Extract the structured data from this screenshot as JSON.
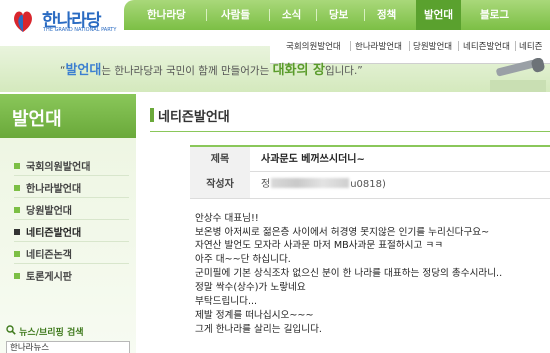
{
  "header": {
    "logo_text": "한나라당",
    "logo_sub": "THE GRAND NATIONAL PARTY",
    "top_nav": [
      "한나라당",
      "사람들",
      "소식",
      "당보",
      "정책",
      "발언대",
      "블로그"
    ],
    "active_top": "발언대",
    "sub_nav": [
      "국회의원발언대",
      "한나라발언대",
      "당원발언대",
      "네티즌발언대",
      "네티즌"
    ],
    "slogan": {
      "pre": "“",
      "word1": "발언대",
      "mid": "는 한나라당과 국민이 함께 만들어가는 ",
      "word2": "대화의 장",
      "post": "입니다.”"
    }
  },
  "sidebar": {
    "title": "발언대",
    "items": [
      {
        "label": "국회의원발언대"
      },
      {
        "label": "한나라발언대"
      },
      {
        "label": "당원발언대"
      },
      {
        "label": "네티즌발언대",
        "active": true
      },
      {
        "label": "네티즌논객"
      },
      {
        "label": "토론게시판"
      }
    ],
    "news_title": "뉴스/브리핑 검색",
    "news_select_value": "한나라뉴스"
  },
  "main": {
    "title": "네티즌발언대",
    "subject_label": "제목",
    "subject_value": "사과문도 베꺼쓰시더니~",
    "writer_label": "작성자",
    "writer_prefix": "정",
    "writer_suffix": "u0818)",
    "body_lines": [
      "안상수 대표님!!",
      "보온병 아저씨로 젊은층 사이에서 허경영 못지않은 인기를 누리신다구요~",
      "자연산 발언도 모자라 사과문 마저 MB사과문 표절하시고 ㅋㅋ",
      "아주 대~~단 하십니다.",
      "군미필에 기본 상식조차 없으신 분이 한 나라를 대표하는 정당의 총수시라니..",
      "정말 싹수(상수)가 노랗네요",
      "부탁드립니다...",
      "제발 정계를 떠나십시오~~~",
      "그게 한나라를 살리는 길입니다."
    ]
  },
  "colors": {
    "nav_green": "#7cbf45",
    "nav_active": "#5aa12e",
    "brand_blue": "#2a6bc2"
  }
}
